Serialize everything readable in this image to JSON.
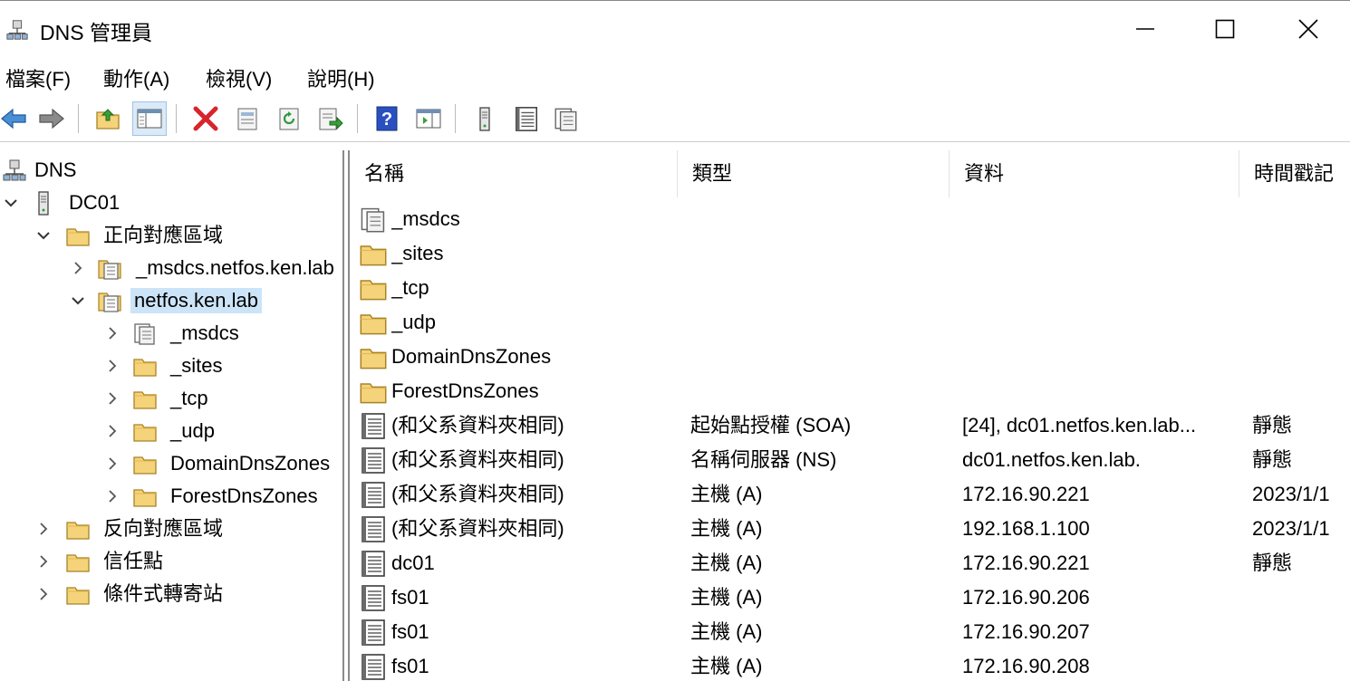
{
  "window": {
    "title": "DNS 管理員"
  },
  "menu": [
    "檔案(F)",
    "動作(A)",
    "檢視(V)",
    "說明(H)"
  ],
  "tree": {
    "root": "DNS",
    "server": "DC01",
    "forward_zones": "正向對應區域",
    "zone_msdcs": "_msdcs.netfos.ken.lab",
    "zone_selected": "netfos.ken.lab",
    "sub_msdcs": "_msdcs",
    "sub_sites": "_sites",
    "sub_tcp": "_tcp",
    "sub_udp": "_udp",
    "sub_domain": "DomainDnsZones",
    "sub_forest": "ForestDnsZones",
    "reverse_zones": "反向對應區域",
    "trust_points": "信任點",
    "conditional_forwarders": "條件式轉寄站"
  },
  "columns": [
    "名稱",
    "類型",
    "資料",
    "時間戳記"
  ],
  "records": [
    {
      "icon": "zone",
      "name": "_msdcs",
      "type": "",
      "data": "",
      "timestamp": ""
    },
    {
      "icon": "folder",
      "name": "_sites",
      "type": "",
      "data": "",
      "timestamp": ""
    },
    {
      "icon": "folder",
      "name": "_tcp",
      "type": "",
      "data": "",
      "timestamp": ""
    },
    {
      "icon": "folder",
      "name": "_udp",
      "type": "",
      "data": "",
      "timestamp": ""
    },
    {
      "icon": "folder",
      "name": "DomainDnsZones",
      "type": "",
      "data": "",
      "timestamp": ""
    },
    {
      "icon": "folder",
      "name": "ForestDnsZones",
      "type": "",
      "data": "",
      "timestamp": ""
    },
    {
      "icon": "record",
      "name": "(和父系資料夾相同)",
      "type": "起始點授權 (SOA)",
      "data": "[24], dc01.netfos.ken.lab...",
      "timestamp": "靜態"
    },
    {
      "icon": "record",
      "name": "(和父系資料夾相同)",
      "type": "名稱伺服器 (NS)",
      "data": "dc01.netfos.ken.lab.",
      "timestamp": "靜態"
    },
    {
      "icon": "record",
      "name": "(和父系資料夾相同)",
      "type": "主機 (A)",
      "data": "172.16.90.221",
      "timestamp": "2023/1/1"
    },
    {
      "icon": "record",
      "name": "(和父系資料夾相同)",
      "type": "主機 (A)",
      "data": "192.168.1.100",
      "timestamp": "2023/1/1"
    },
    {
      "icon": "record",
      "name": "dc01",
      "type": "主機 (A)",
      "data": "172.16.90.221",
      "timestamp": "靜態"
    },
    {
      "icon": "record",
      "name": "fs01",
      "type": "主機 (A)",
      "data": "172.16.90.206",
      "timestamp": ""
    },
    {
      "icon": "record",
      "name": "fs01",
      "type": "主機 (A)",
      "data": "172.16.90.207",
      "timestamp": ""
    },
    {
      "icon": "record",
      "name": "fs01",
      "type": "主機 (A)",
      "data": "172.16.90.208",
      "timestamp": ""
    }
  ],
  "colors": {
    "selection": "#cce4f7",
    "folder": "#f5d37a",
    "folder_border": "#c9a13a",
    "delete_red": "#d9242b",
    "help_blue": "#2a4fbf"
  },
  "toolbar_icons": [
    "back-arrow-icon",
    "forward-arrow-icon",
    "up-folder-icon",
    "show-hide-tree-icon",
    "delete-icon",
    "properties-icon",
    "refresh-icon",
    "export-list-icon",
    "help-icon",
    "console-view-icon",
    "server-icon",
    "list-icon",
    "copy-icon"
  ]
}
